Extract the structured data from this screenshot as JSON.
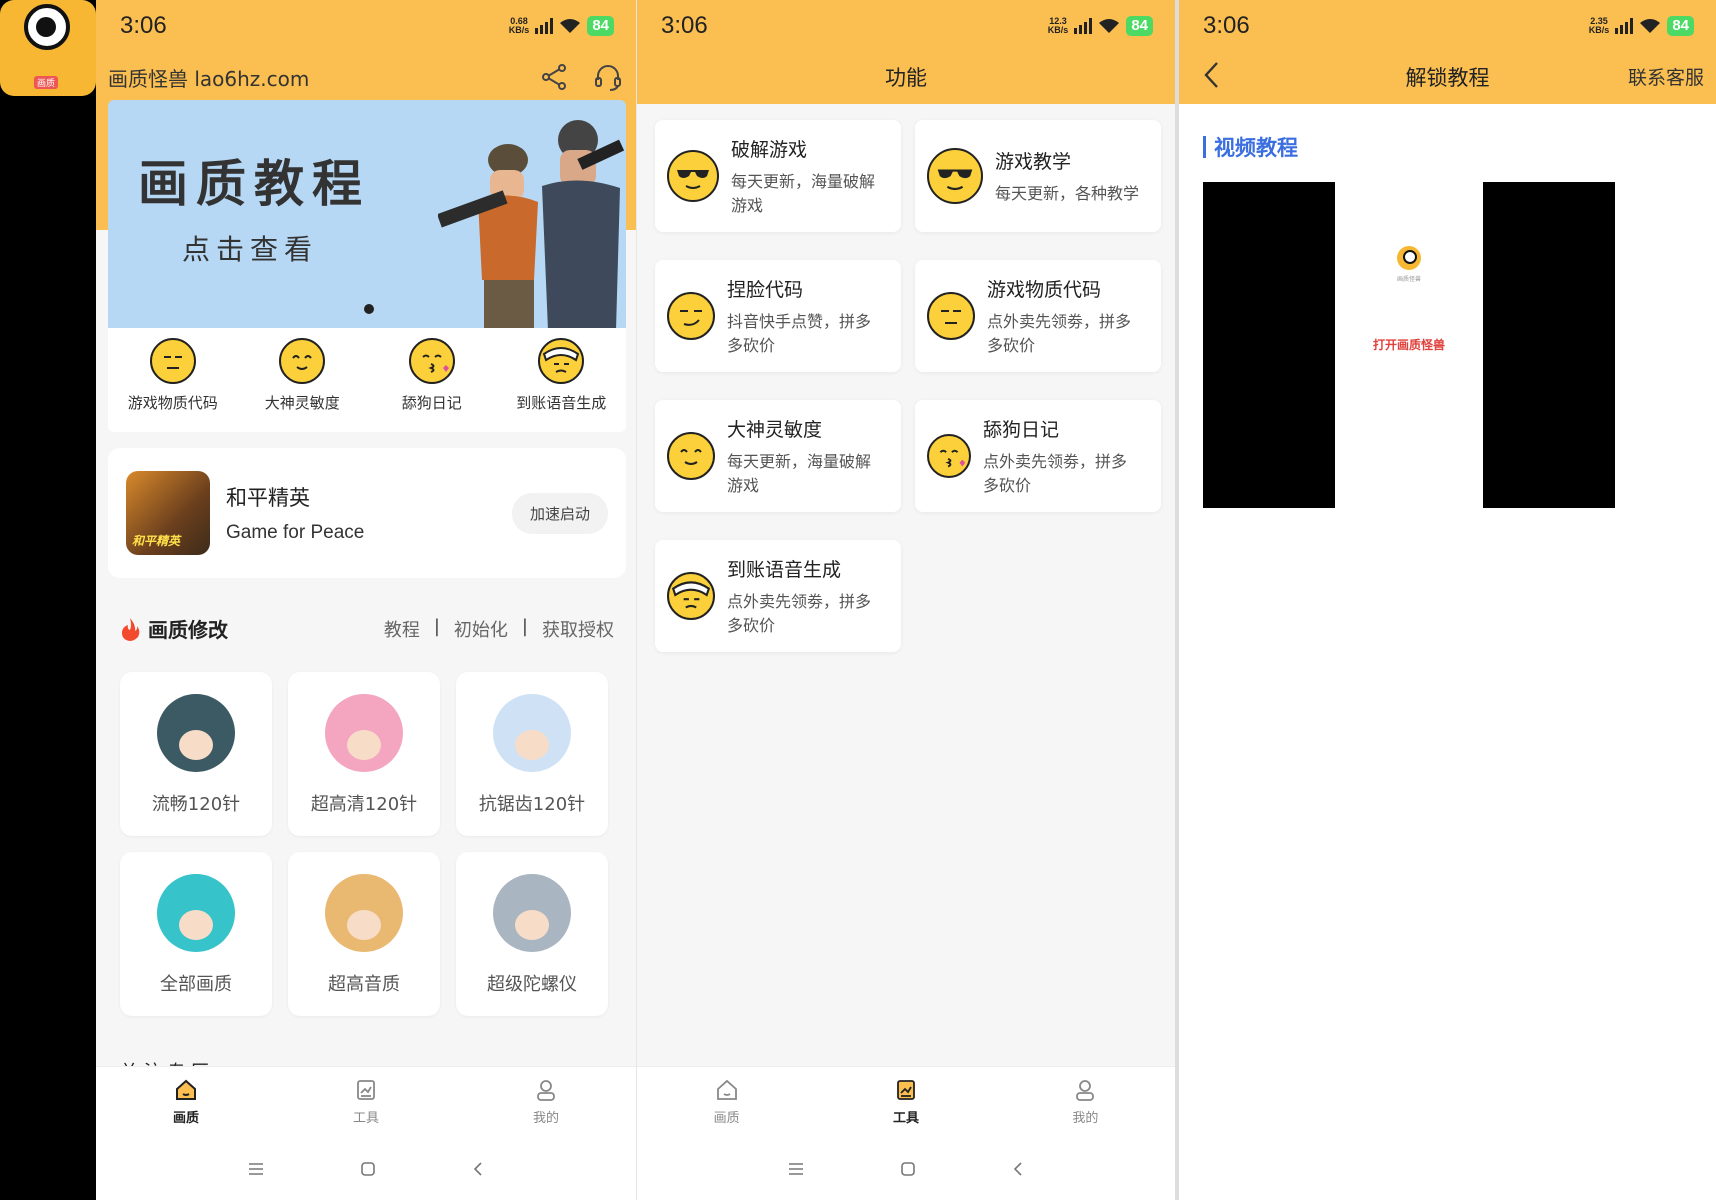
{
  "app_icon": {
    "badge": "画质"
  },
  "screens": [
    {
      "time": "3:06",
      "net_speed": "0.68",
      "net_unit": "KB/s",
      "battery": "84"
    },
    {
      "time": "3:06",
      "net_speed": "12.3",
      "net_unit": "KB/s",
      "battery": "84"
    },
    {
      "time": "3:06",
      "net_speed": "2.35",
      "net_unit": "KB/s",
      "battery": "84"
    }
  ],
  "home": {
    "brand": "画质怪兽 lao6hz.com",
    "banner": {
      "title": "画质教程",
      "subtitle": "点击查看"
    },
    "quick_items": [
      {
        "label": "游戏物质代码",
        "icon": "neutral-face-icon"
      },
      {
        "label": "大神灵敏度",
        "icon": "smile-face-icon"
      },
      {
        "label": "舔狗日记",
        "icon": "kiss-face-icon"
      },
      {
        "label": "到账语音生成",
        "icon": "bandage-face-icon"
      }
    ],
    "game": {
      "name": "和平精英",
      "name_en": "Game for Peace",
      "button": "加速启动",
      "logo_text": "和平精英"
    },
    "section": {
      "title": "画质修改",
      "links": [
        "教程",
        "初始化",
        "获取授权"
      ]
    },
    "cards": [
      {
        "label": "流畅120针",
        "color": "#3b5a63"
      },
      {
        "label": "超高清120针",
        "color": "#f4a5c0"
      },
      {
        "label": "抗锯齿120针",
        "color": "#cfe2f5"
      },
      {
        "label": "全部画质",
        "color": "#36c3c9"
      },
      {
        "label": "超高音质",
        "color": "#e9b871"
      },
      {
        "label": "超级陀螺仪",
        "color": "#a9b6c2"
      }
    ],
    "peek_title": "关 注 专 区"
  },
  "tabs": [
    {
      "label": "画质",
      "icon": "home-icon"
    },
    {
      "label": "工具",
      "icon": "tools-icon"
    },
    {
      "label": "我的",
      "icon": "profile-icon"
    }
  ],
  "functions": {
    "title": "功能",
    "items": [
      {
        "title": "破解游戏",
        "desc": "每天更新，海量破解游戏",
        "icon": "sunglasses-face-icon"
      },
      {
        "title": "游戏教学",
        "desc": "每天更新，各种教学",
        "icon": "sunglasses-face-icon"
      },
      {
        "title": "捏脸代码",
        "desc": "抖音快手点赞，拼多多砍价",
        "icon": "smirk-face-icon"
      },
      {
        "title": "游戏物质代码",
        "desc": "点外卖先领劵，拼多多砍价",
        "icon": "neutral-face-icon"
      },
      {
        "title": "大神灵敏度",
        "desc": "每天更新，海量破解游戏",
        "icon": "smile-face-icon"
      },
      {
        "title": "舔狗日记",
        "desc": "点外卖先领劵，拼多多砍价",
        "icon": "kiss-face-icon"
      },
      {
        "title": "到账语音生成",
        "desc": "点外卖先领劵，拼多多砍价",
        "icon": "bandage-face-icon"
      }
    ]
  },
  "tutorial": {
    "title": "解锁教程",
    "contact": "联系客服",
    "section": "视频教程",
    "video_app_name": "画质怪兽",
    "video_button": "打开画质怪兽"
  },
  "colors": {
    "accent": "#fbbf51",
    "link_blue": "#3b6fe0",
    "battery": "#4cd964",
    "red": "#e0413c"
  }
}
